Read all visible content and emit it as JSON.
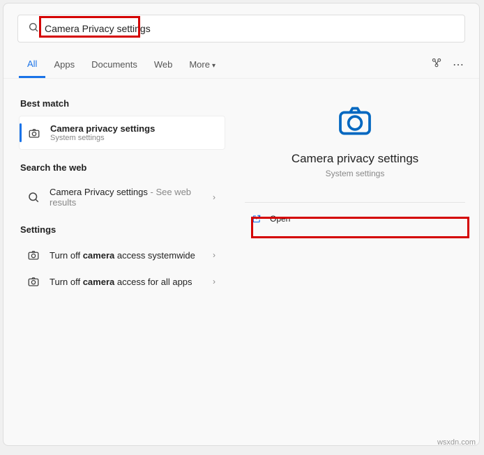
{
  "search": {
    "value": "Camera Privacy settings"
  },
  "tabs": {
    "all": "All",
    "apps": "Apps",
    "documents": "Documents",
    "web": "Web",
    "more": "More"
  },
  "sections": {
    "bestMatch": "Best match",
    "searchWeb": "Search the web",
    "settings": "Settings"
  },
  "bestMatch": {
    "title": "Camera privacy settings",
    "sub": "System settings"
  },
  "webResult": {
    "titlePrefix": "Camera Privacy settings",
    "suffix": " - See web results"
  },
  "settingsResults": {
    "r1_pre": "Turn off ",
    "r1_bold": "camera",
    "r1_post": " access systemwide",
    "r2_pre": "Turn off ",
    "r2_bold": "camera",
    "r2_post": " access for all apps"
  },
  "detail": {
    "title": "Camera privacy settings",
    "sub": "System settings",
    "open": "Open"
  },
  "watermark": "wsxdn.com"
}
